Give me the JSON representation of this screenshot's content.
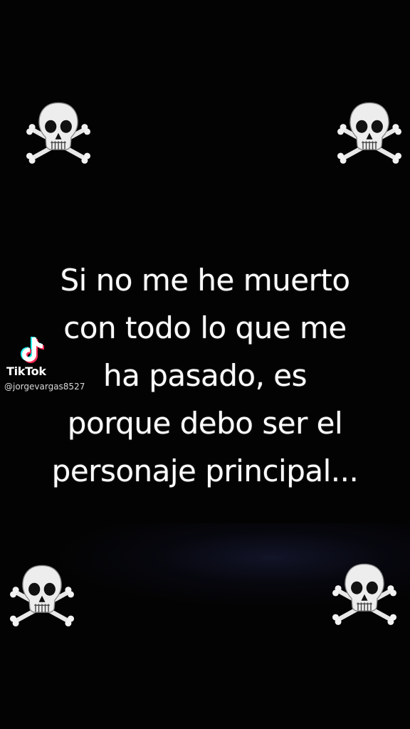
{
  "quote": {
    "text": "Si no me he muerto\ncon todo lo que me\nha pasado, es\nporque debo ser el\npersonaje principal..."
  },
  "watermark": {
    "brand": "TikTok",
    "handle": "@jorgevargas8527",
    "icon": "tiktok-note-icon"
  },
  "decorations": {
    "icon": "skull-crossbones-icon",
    "count": 4
  },
  "colors": {
    "background": "#030303",
    "text": "#ffffff",
    "tiktok_cyan": "#25f4ee",
    "tiktok_red": "#fe2c55"
  }
}
